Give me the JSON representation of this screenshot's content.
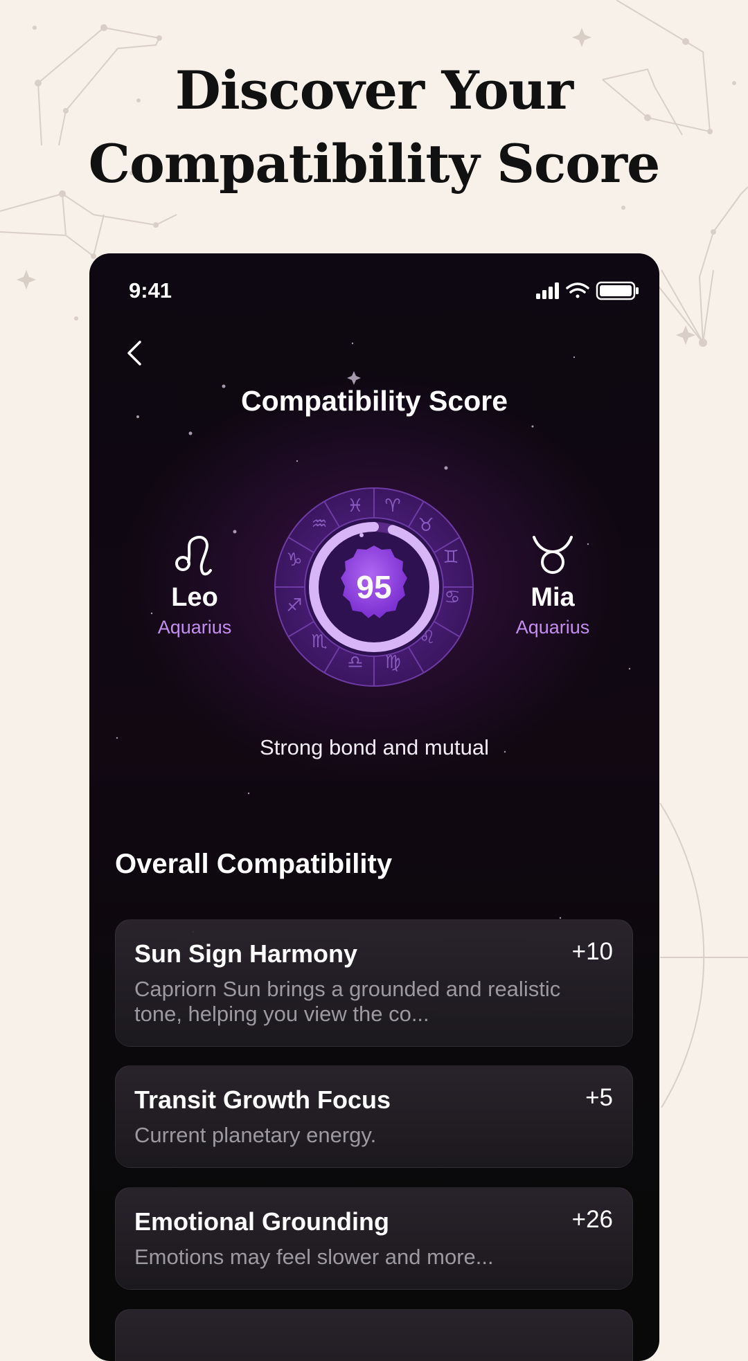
{
  "headline": {
    "line1": "Discover Your",
    "line2": "Compatibility Score"
  },
  "status_bar": {
    "time": "9:41"
  },
  "header": {
    "title": "Compatibility Score"
  },
  "person_left": {
    "sign_icon": "leo-icon",
    "name": "Leo",
    "rising": "Aquarius"
  },
  "person_right": {
    "sign_icon": "taurus-icon",
    "name": "Mia",
    "rising": "Aquarius"
  },
  "score": {
    "value": "95",
    "fraction": 0.95
  },
  "tagline": "Strong bond and mutual",
  "overall": {
    "title": "Overall Compatibility",
    "items": [
      {
        "title": "Sun Sign Harmony",
        "points": "+10",
        "description": "Capriorn Sun brings a grounded and realistic tone, helping you view the co..."
      },
      {
        "title": "Transit Growth Focus",
        "points": "+5",
        "description": "Current planetary energy."
      },
      {
        "title": "Emotional Grounding",
        "points": "+26",
        "description": "Emotions may feel slower and more..."
      }
    ]
  },
  "colors": {
    "page_background": "#f8f1ea",
    "accent_purple": "#c38ef0",
    "score_badge": "#8a3fd6"
  }
}
